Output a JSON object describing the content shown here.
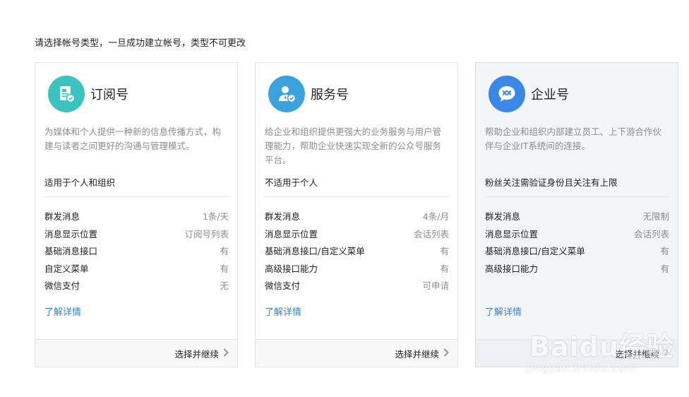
{
  "intro": "请选择帐号类型，一旦成功建立帐号，类型不可更改",
  "colors": {
    "subscription": "#3cc3c0",
    "service": "#3aa3de",
    "enterprise": "#3a87e6",
    "link": "#2f86d6"
  },
  "cards": [
    {
      "title": "订阅号",
      "icon": "document-check-icon",
      "desc": "为媒体和个人提供一种新的信息传播方式，构建与读者之间更好的沟通与管理模式。",
      "scope": "适用于个人和组织",
      "features": [
        {
          "k": "群发消息",
          "v": "1条/天"
        },
        {
          "k": "消息显示位置",
          "v": "订阅号列表"
        },
        {
          "k": "基础消息接口",
          "v": "有"
        },
        {
          "k": "自定义菜单",
          "v": "有"
        },
        {
          "k": "微信支付",
          "v": "无"
        }
      ],
      "more": "了解详情",
      "next": "选择并继续"
    },
    {
      "title": "服务号",
      "icon": "person-check-icon",
      "desc": "给企业和组织提供更强大的业务服务与用户管理能力，帮助企业快速实现全新的公众号服务平台。",
      "scope": "不适用于个人",
      "features": [
        {
          "k": "群发消息",
          "v": "4条/月"
        },
        {
          "k": "消息显示位置",
          "v": "会话列表"
        },
        {
          "k": "基础消息接口/自定义菜单",
          "v": "有"
        },
        {
          "k": "高级接口能力",
          "v": "有"
        },
        {
          "k": "微信支付",
          "v": "可申请"
        }
      ],
      "more": "了解详情",
      "next": "选择并继续"
    },
    {
      "title": "企业号",
      "icon": "enterprise-chat-icon",
      "desc": "帮助企业和组织内部建立员工、上下游合作伙伴与企业IT系统间的连接。",
      "scope": "粉丝关注需验证身份且关注有上限",
      "features": [
        {
          "k": "群发消息",
          "v": "无限制"
        },
        {
          "k": "消息显示位置",
          "v": "会话列表"
        },
        {
          "k": "基础消息接口/自定义菜单",
          "v": "有"
        },
        {
          "k": "高级接口能力",
          "v": "有"
        }
      ],
      "more": "了解详情",
      "next": "选择并继续"
    }
  ],
  "watermark": {
    "top": "Baidu经验",
    "bottom": "jingyan.baidu.com"
  }
}
